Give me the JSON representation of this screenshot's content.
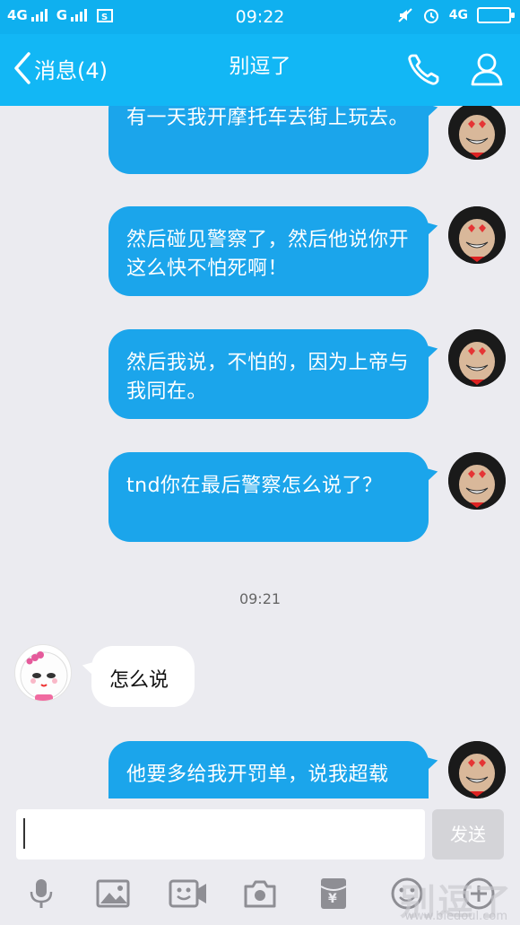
{
  "status_bar": {
    "left_network_1": "4G",
    "left_network_2": "G",
    "time": "09:22",
    "right_network": "4G"
  },
  "header": {
    "back_label": "消息(4)",
    "title": "别逗了"
  },
  "messages": [
    {
      "side": "out",
      "text": "有一天我开摩托车去街上玩去。"
    },
    {
      "side": "out",
      "text": "然后碰见警察了，然后他说你开这么快不怕死啊！"
    },
    {
      "side": "out",
      "text": "然后我说，不怕的，因为上帝与我同在。"
    },
    {
      "side": "out",
      "text": "tnd你在最后警察怎么说了？"
    },
    {
      "side": "timestamp",
      "text": "09:21"
    },
    {
      "side": "in",
      "text": "怎么说"
    },
    {
      "side": "out",
      "text": "他要多给我开罚单，说我超载"
    }
  ],
  "composer": {
    "value": "",
    "send_label": "发送"
  },
  "toolbar": {
    "items": [
      "microphone-icon",
      "image-icon",
      "video-call-icon",
      "camera-icon",
      "red-packet-icon",
      "emoji-icon",
      "plus-icon"
    ]
  },
  "watermark": {
    "text": "别逗了",
    "url": "www.biedoul.com"
  },
  "colors": {
    "header_bg": "#12b7f5",
    "bubble_out": "#1ba5eb",
    "bubble_in": "#ffffff",
    "chat_bg": "#ebebf0"
  }
}
